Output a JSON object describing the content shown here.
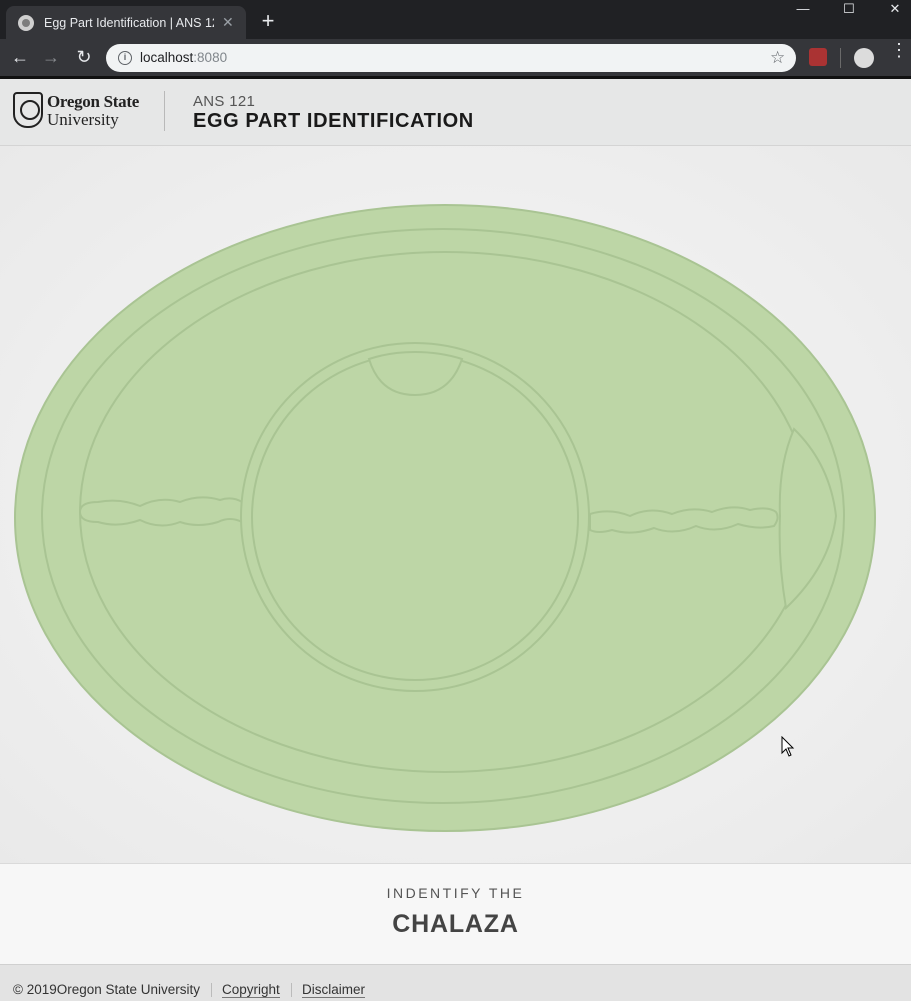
{
  "browser": {
    "tab_title": "Egg Part Identification | ANS 121",
    "tab_close": "✕",
    "new_tab": "+",
    "window_controls": {
      "minimize": "—",
      "maximize": "☐",
      "close": "✕"
    },
    "nav": {
      "back": "←",
      "forward": "→",
      "reload": "↻"
    },
    "url_host": "localhost",
    "url_port": ":8080",
    "info_icon": "i",
    "star": "☆",
    "menu": "⋮"
  },
  "header": {
    "logo_line1": "Oregon State",
    "logo_line2": "University",
    "course": "ANS 121",
    "title": "EGG PART IDENTIFICATION"
  },
  "diagram": {
    "fill": "#bdd6a6",
    "stroke": "#a9c493"
  },
  "prompt": {
    "label": "INDENTIFY THE",
    "target": "CHALAZA"
  },
  "footer": {
    "copyright": "© 2019Oregon State University",
    "link_copyright": "Copyright",
    "link_disclaimer": "Disclaimer"
  }
}
